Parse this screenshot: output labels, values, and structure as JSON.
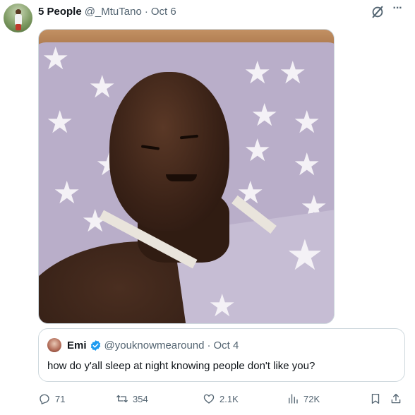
{
  "author": {
    "display_name": "5 People",
    "handle": "@_MtuTano",
    "separator": "·",
    "date": "Oct 6"
  },
  "header_icons": [
    "grok-icon",
    "more-icon"
  ],
  "more_label": "···",
  "media": {
    "icons": [
      "star-icon"
    ]
  },
  "quoted_tweet": {
    "display_name": "Emi",
    "verified": true,
    "handle": "@youknowmearound",
    "separator": "·",
    "date": "Oct 4",
    "text": "how do y'all sleep at night knowing people don't like you?"
  },
  "actions": {
    "replies": "71",
    "reposts": "354",
    "likes": "2.1K",
    "views": "72K"
  },
  "colors": {
    "text_primary": "#0f1419",
    "text_secondary": "#536471",
    "border": "#cfd9de",
    "verified_blue": "#1d9bf0"
  }
}
